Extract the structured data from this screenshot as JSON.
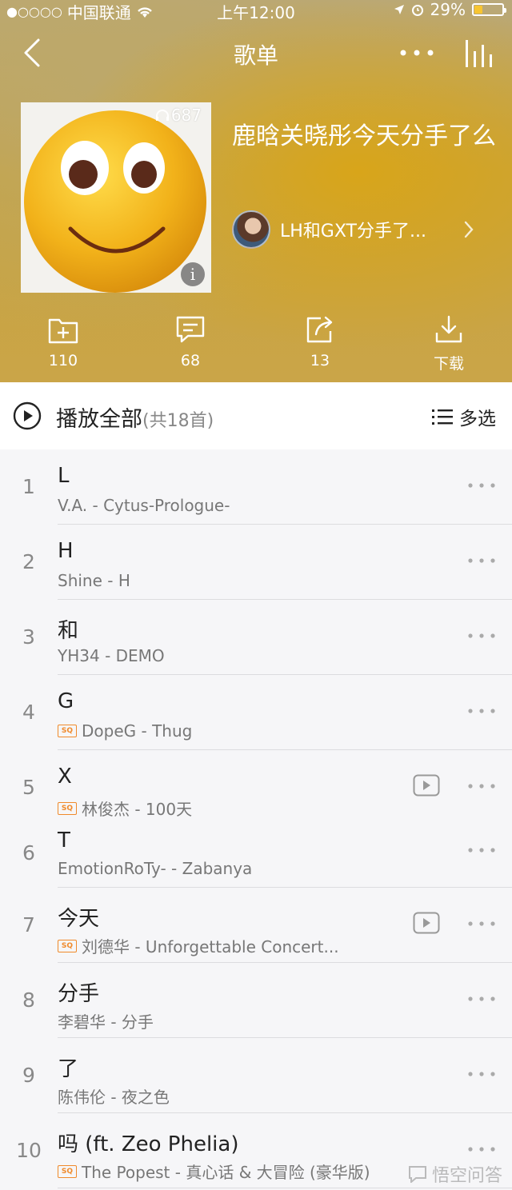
{
  "status_bar": {
    "carrier": "中国联通",
    "time": "上午12:00",
    "battery": "29%",
    "battery_level": 0.29
  },
  "nav": {
    "title": "歌单"
  },
  "playlist": {
    "play_count": "687",
    "title": "鹿晗关晓彤今天分手了么",
    "creator": "LH和GXT分手了..."
  },
  "actions": [
    {
      "icon": "add-folder-icon",
      "label": "110"
    },
    {
      "icon": "comment-icon",
      "label": "68"
    },
    {
      "icon": "share-icon",
      "label": "13"
    },
    {
      "icon": "download-icon",
      "label": "下载"
    }
  ],
  "play_all": {
    "label": "播放全部",
    "count": "(共18首)",
    "multi_select": "多选"
  },
  "songs": [
    {
      "index": "1",
      "title": "L",
      "meta": "V.A. - Cytus-Prologue-",
      "sq": false,
      "mv": false
    },
    {
      "index": "2",
      "title": "H",
      "meta": "Shine - H",
      "sq": false,
      "mv": false
    },
    {
      "index": "3",
      "title": "和",
      "meta": "YH34 - DEMO",
      "sq": false,
      "mv": false
    },
    {
      "index": "4",
      "title": "G",
      "meta": "DopeG - Thug",
      "sq": true,
      "mv": false
    },
    {
      "index": "5",
      "title": "X",
      "meta": "林俊杰 - 100天",
      "sq": true,
      "mv": true
    },
    {
      "index": "6",
      "title": "T",
      "meta": "EmotionRoTy- - Zabanya",
      "sq": false,
      "mv": false
    },
    {
      "index": "7",
      "title": "今天",
      "meta": "刘德华 - Unforgettable Concert...",
      "sq": true,
      "mv": true
    },
    {
      "index": "8",
      "title": "分手",
      "meta": "李碧华 - 分手",
      "sq": false,
      "mv": false
    },
    {
      "index": "9",
      "title": "了",
      "meta": "陈伟伦 - 夜之色",
      "sq": false,
      "mv": false
    },
    {
      "index": "10",
      "title": "吗 (ft. Zeo Phelia)",
      "meta": "The Popest - 真心话 & 大冒险 (豪华版)",
      "sq": true,
      "mv": false
    }
  ],
  "sq_badge": "SQ",
  "watermark": "悟空问答"
}
